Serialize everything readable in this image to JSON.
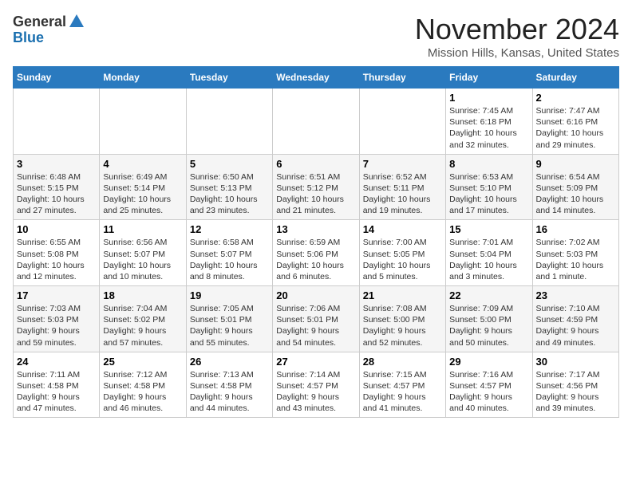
{
  "header": {
    "logo_general": "General",
    "logo_blue": "Blue",
    "month": "November 2024",
    "location": "Mission Hills, Kansas, United States"
  },
  "days_of_week": [
    "Sunday",
    "Monday",
    "Tuesday",
    "Wednesday",
    "Thursday",
    "Friday",
    "Saturday"
  ],
  "weeks": [
    [
      {
        "day": "",
        "info": ""
      },
      {
        "day": "",
        "info": ""
      },
      {
        "day": "",
        "info": ""
      },
      {
        "day": "",
        "info": ""
      },
      {
        "day": "",
        "info": ""
      },
      {
        "day": "1",
        "info": "Sunrise: 7:45 AM\nSunset: 6:18 PM\nDaylight: 10 hours\nand 32 minutes."
      },
      {
        "day": "2",
        "info": "Sunrise: 7:47 AM\nSunset: 6:16 PM\nDaylight: 10 hours\nand 29 minutes."
      }
    ],
    [
      {
        "day": "3",
        "info": "Sunrise: 6:48 AM\nSunset: 5:15 PM\nDaylight: 10 hours\nand 27 minutes."
      },
      {
        "day": "4",
        "info": "Sunrise: 6:49 AM\nSunset: 5:14 PM\nDaylight: 10 hours\nand 25 minutes."
      },
      {
        "day": "5",
        "info": "Sunrise: 6:50 AM\nSunset: 5:13 PM\nDaylight: 10 hours\nand 23 minutes."
      },
      {
        "day": "6",
        "info": "Sunrise: 6:51 AM\nSunset: 5:12 PM\nDaylight: 10 hours\nand 21 minutes."
      },
      {
        "day": "7",
        "info": "Sunrise: 6:52 AM\nSunset: 5:11 PM\nDaylight: 10 hours\nand 19 minutes."
      },
      {
        "day": "8",
        "info": "Sunrise: 6:53 AM\nSunset: 5:10 PM\nDaylight: 10 hours\nand 17 minutes."
      },
      {
        "day": "9",
        "info": "Sunrise: 6:54 AM\nSunset: 5:09 PM\nDaylight: 10 hours\nand 14 minutes."
      }
    ],
    [
      {
        "day": "10",
        "info": "Sunrise: 6:55 AM\nSunset: 5:08 PM\nDaylight: 10 hours\nand 12 minutes."
      },
      {
        "day": "11",
        "info": "Sunrise: 6:56 AM\nSunset: 5:07 PM\nDaylight: 10 hours\nand 10 minutes."
      },
      {
        "day": "12",
        "info": "Sunrise: 6:58 AM\nSunset: 5:07 PM\nDaylight: 10 hours\nand 8 minutes."
      },
      {
        "day": "13",
        "info": "Sunrise: 6:59 AM\nSunset: 5:06 PM\nDaylight: 10 hours\nand 6 minutes."
      },
      {
        "day": "14",
        "info": "Sunrise: 7:00 AM\nSunset: 5:05 PM\nDaylight: 10 hours\nand 5 minutes."
      },
      {
        "day": "15",
        "info": "Sunrise: 7:01 AM\nSunset: 5:04 PM\nDaylight: 10 hours\nand 3 minutes."
      },
      {
        "day": "16",
        "info": "Sunrise: 7:02 AM\nSunset: 5:03 PM\nDaylight: 10 hours\nand 1 minute."
      }
    ],
    [
      {
        "day": "17",
        "info": "Sunrise: 7:03 AM\nSunset: 5:03 PM\nDaylight: 9 hours\nand 59 minutes."
      },
      {
        "day": "18",
        "info": "Sunrise: 7:04 AM\nSunset: 5:02 PM\nDaylight: 9 hours\nand 57 minutes."
      },
      {
        "day": "19",
        "info": "Sunrise: 7:05 AM\nSunset: 5:01 PM\nDaylight: 9 hours\nand 55 minutes."
      },
      {
        "day": "20",
        "info": "Sunrise: 7:06 AM\nSunset: 5:01 PM\nDaylight: 9 hours\nand 54 minutes."
      },
      {
        "day": "21",
        "info": "Sunrise: 7:08 AM\nSunset: 5:00 PM\nDaylight: 9 hours\nand 52 minutes."
      },
      {
        "day": "22",
        "info": "Sunrise: 7:09 AM\nSunset: 5:00 PM\nDaylight: 9 hours\nand 50 minutes."
      },
      {
        "day": "23",
        "info": "Sunrise: 7:10 AM\nSunset: 4:59 PM\nDaylight: 9 hours\nand 49 minutes."
      }
    ],
    [
      {
        "day": "24",
        "info": "Sunrise: 7:11 AM\nSunset: 4:58 PM\nDaylight: 9 hours\nand 47 minutes."
      },
      {
        "day": "25",
        "info": "Sunrise: 7:12 AM\nSunset: 4:58 PM\nDaylight: 9 hours\nand 46 minutes."
      },
      {
        "day": "26",
        "info": "Sunrise: 7:13 AM\nSunset: 4:58 PM\nDaylight: 9 hours\nand 44 minutes."
      },
      {
        "day": "27",
        "info": "Sunrise: 7:14 AM\nSunset: 4:57 PM\nDaylight: 9 hours\nand 43 minutes."
      },
      {
        "day": "28",
        "info": "Sunrise: 7:15 AM\nSunset: 4:57 PM\nDaylight: 9 hours\nand 41 minutes."
      },
      {
        "day": "29",
        "info": "Sunrise: 7:16 AM\nSunset: 4:57 PM\nDaylight: 9 hours\nand 40 minutes."
      },
      {
        "day": "30",
        "info": "Sunrise: 7:17 AM\nSunset: 4:56 PM\nDaylight: 9 hours\nand 39 minutes."
      }
    ]
  ]
}
